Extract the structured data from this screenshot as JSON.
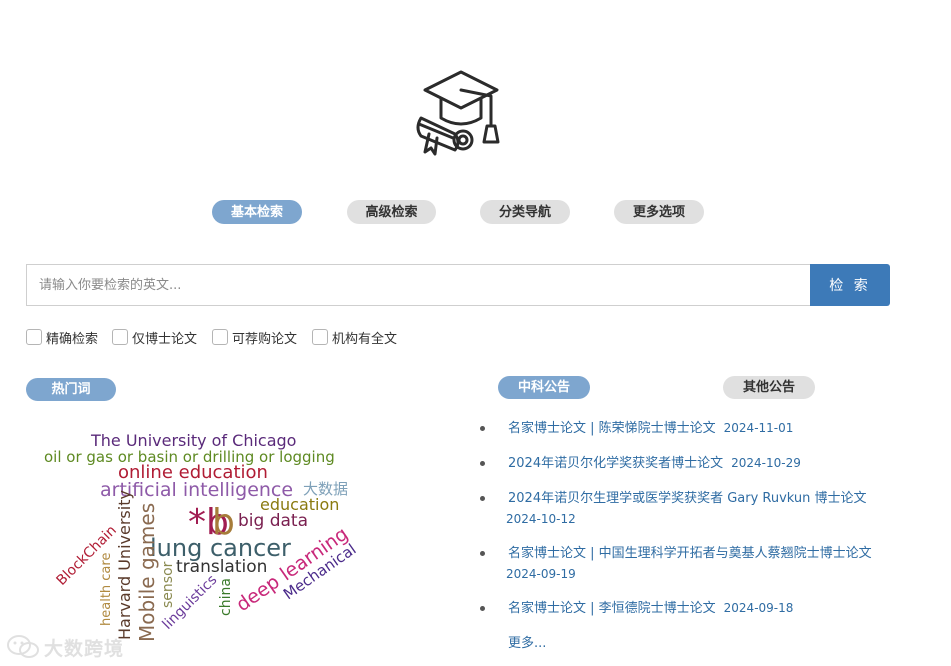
{
  "tabs": [
    {
      "label": "基本检索",
      "active": true
    },
    {
      "label": "高级检索",
      "active": false
    },
    {
      "label": "分类导航",
      "active": false
    },
    {
      "label": "更多选项",
      "active": false
    }
  ],
  "search": {
    "placeholder": "请输入你要检索的英文...",
    "button_label": "检 索"
  },
  "options": [
    "精确检索",
    "仅博士论文",
    "可荐购论文",
    "机构有全文"
  ],
  "hotwords": {
    "label": "热门词",
    "words": [
      {
        "text": "The University of Chicago",
        "color": "#5a2a7a"
      },
      {
        "text": "oil or gas or basin or drilling or logging",
        "color": "#5e8a22"
      },
      {
        "text": "online education",
        "color": "#b01c34"
      },
      {
        "text": "artificial intelligence",
        "color": "#8e5aa8"
      },
      {
        "text": "大数据",
        "color": "#7ea0b8"
      },
      {
        "text": "education",
        "color": "#8a7a10"
      },
      {
        "text": "*b",
        "color": "#a11d52"
      },
      {
        "text": "b",
        "color": "#a67c3a"
      },
      {
        "text": "big data",
        "color": "#7a2050"
      },
      {
        "text": "lung cancer",
        "color": "#3d5f6a"
      },
      {
        "text": "translation",
        "color": "#333333"
      },
      {
        "text": "deep learning",
        "color": "#c8287a"
      },
      {
        "text": "Mechanical",
        "color": "#4a2a8a"
      },
      {
        "text": "Harvard University",
        "color": "#5a3a2a"
      },
      {
        "text": "Mobile games",
        "color": "#8a6a50"
      },
      {
        "text": "BlockChain",
        "color": "#b01c34"
      },
      {
        "text": "health care",
        "color": "#b08a40"
      },
      {
        "text": "sensor",
        "color": "#8a8a50"
      },
      {
        "text": "linguistics",
        "color": "#6a3a9a"
      },
      {
        "text": "china",
        "color": "#3a7a2a"
      }
    ]
  },
  "announcements": {
    "tab_primary": "中科公告",
    "tab_secondary": "其他公告",
    "items": [
      {
        "title": "名家博士论文 | 陈荣悌院士博士论文",
        "date": "2024-11-01"
      },
      {
        "title": "2024年诺贝尔化学奖获奖者博士论文",
        "date": "2024-10-29"
      },
      {
        "title": "2024年诺贝尔生理学或医学奖获奖者 Gary Ruvkun 博士论文",
        "date": "2024-10-12"
      },
      {
        "title": "名家博士论文 | 中国生理科学开拓者与奠基人蔡翘院士博士论文",
        "date": "2024-09-19"
      },
      {
        "title": "名家博士论文 | 李恒德院士博士论文",
        "date": "2024-09-18"
      }
    ],
    "more_label": "更多..."
  },
  "watermark": {
    "text": "大数跨境"
  },
  "icons": {
    "logo": "graduation-cap-diploma-icon",
    "watermark": "wechat-icon"
  }
}
